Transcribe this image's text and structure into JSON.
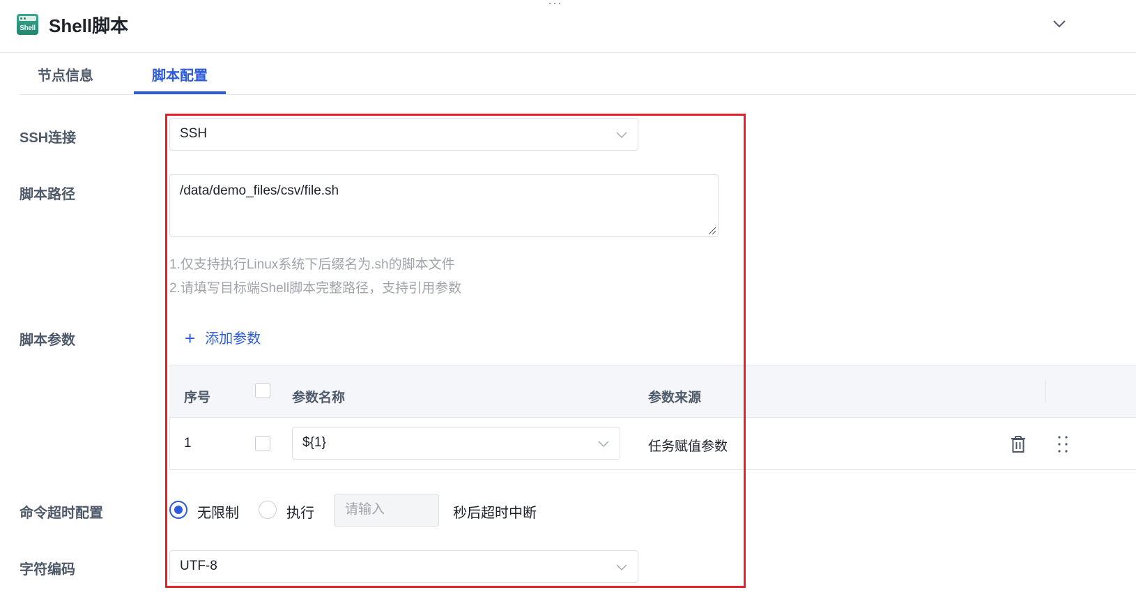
{
  "header": {
    "drag_handle": "···",
    "app_icon_text": "Shell",
    "title": "Shell脚本",
    "collapse_icon": "chevron-down-icon"
  },
  "tabs": [
    {
      "label": "节点信息",
      "active": false
    },
    {
      "label": "脚本配置",
      "active": true
    }
  ],
  "form": {
    "ssh": {
      "label": "SSH连接",
      "value": "SSH"
    },
    "script_path": {
      "label": "脚本路径",
      "value": "/data/demo_files/csv/file.sh",
      "hints": [
        "1.仅支持执行Linux系统下后缀名为.sh的脚本文件",
        "2.请填写目标端Shell脚本完整路径，支持引用参数"
      ]
    },
    "script_params": {
      "label": "脚本参数",
      "add_label": "添加参数",
      "columns": [
        "序号",
        "参数名称",
        "参数来源"
      ],
      "rows": [
        {
          "index": "1",
          "name": "${1}",
          "source": "任务赋值参数"
        }
      ]
    },
    "timeout": {
      "label": "命令超时配置",
      "option_unlimited": "无限制",
      "option_execute": "执行",
      "selected": "无限制",
      "input_placeholder": "请输入",
      "suffix": "秒后超时中断"
    },
    "encoding": {
      "label": "字符编码",
      "value": "UTF-8"
    }
  },
  "colors": {
    "accent": "#2d5bdc",
    "highlight_border": "#e8202a",
    "brand_icon": "#23866f"
  }
}
